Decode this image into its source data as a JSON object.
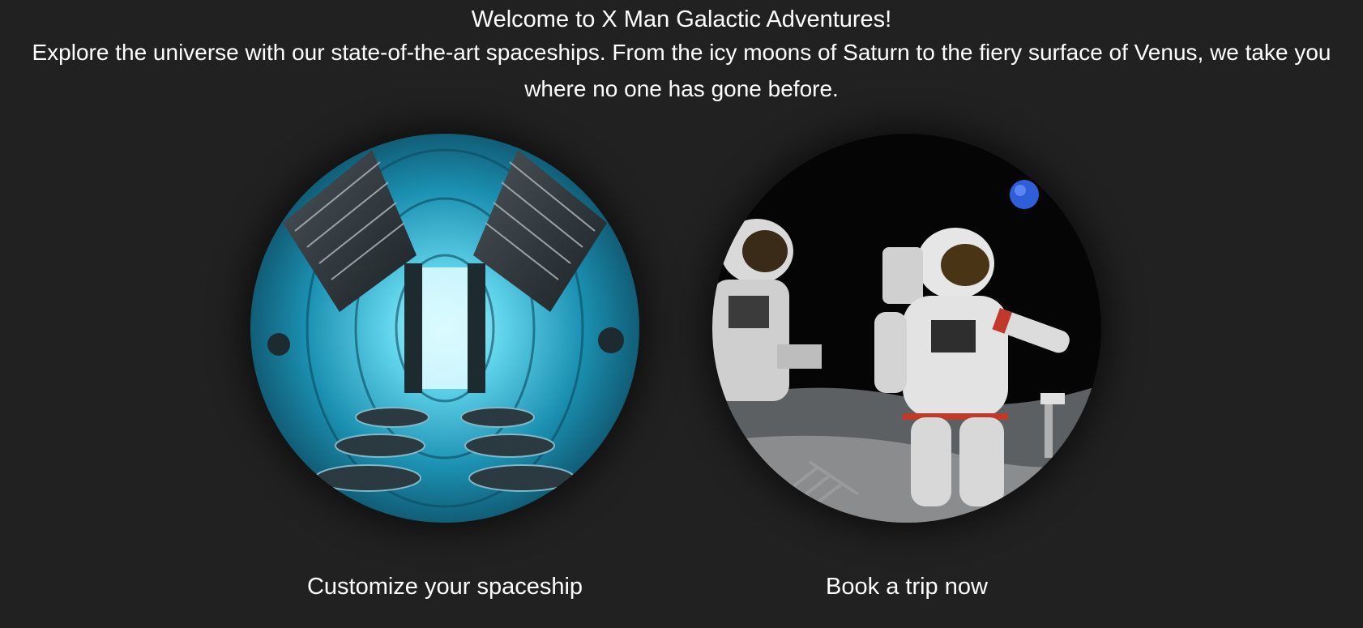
{
  "hero": {
    "title": "Welcome to X Man Galactic Adventures!",
    "tagline": "Explore the universe with our state-of-the-art spaceships. From the icy moons of Saturn to the fiery surface of Venus, we take you where no one has gone before."
  },
  "cards": [
    {
      "label": "Customize your spaceship",
      "image": "spaceship-interior-image"
    },
    {
      "label": "Book a trip now",
      "image": "astronauts-on-moon-image"
    }
  ],
  "colors": {
    "background": "#212121",
    "text": "#ffffff",
    "interior_accent": "#29b6d6",
    "space_black": "#050505"
  }
}
